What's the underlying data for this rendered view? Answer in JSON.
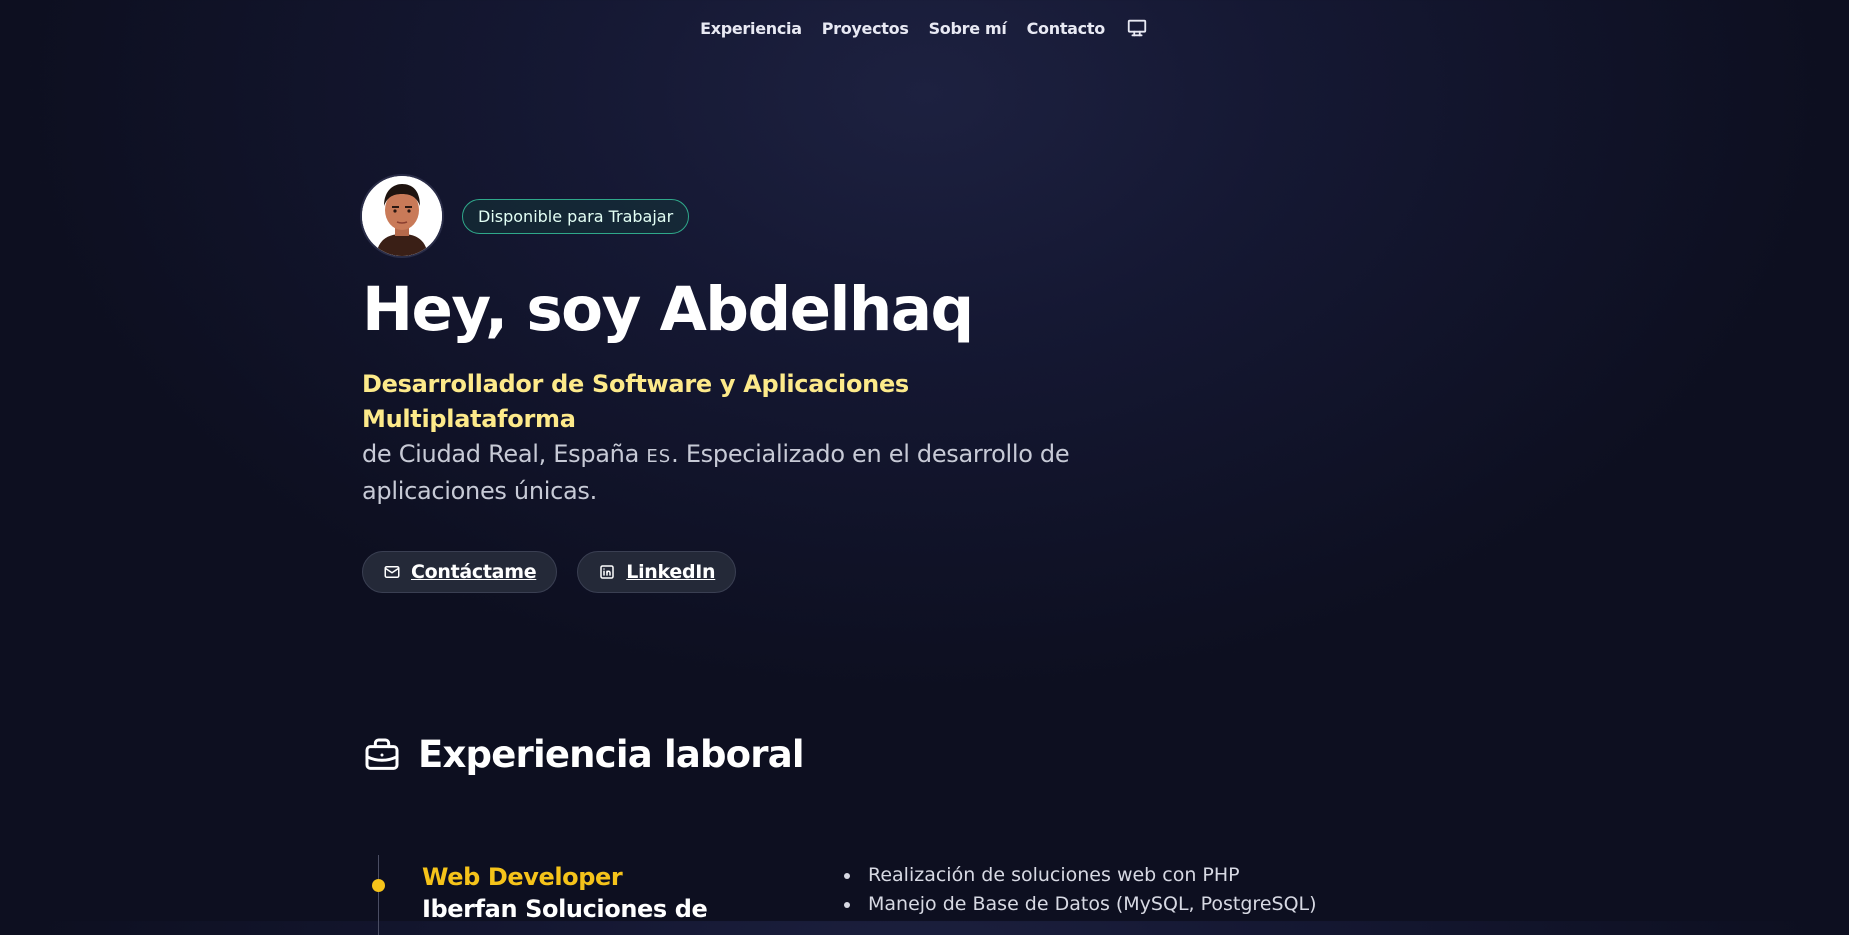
{
  "nav": {
    "items": [
      "Experiencia",
      "Proyectos",
      "Sobre mí",
      "Contacto"
    ],
    "theme_icon": "monitor-icon"
  },
  "hero": {
    "status_badge": "Disponible para Trabajar",
    "title": "Hey, soy Abdelhaq",
    "role": "Desarrollador de Software y Aplicaciones Multiplataforma",
    "location_prefix": "de Ciudad Real, España",
    "flag": "ES",
    "description_suffix": ". Especializado en el desarrollo de aplicaciones únicas.",
    "buttons": {
      "contact": "Contáctame",
      "linkedin": "LinkedIn"
    }
  },
  "experience": {
    "section_title": "Experiencia laboral",
    "section_icon": "briefcase-icon",
    "jobs": [
      {
        "role": "Web Developer",
        "company": "Iberfan Soluciones de",
        "tasks": [
          "Realización de soluciones web con PHP",
          "Manejo de Base de Datos (MySQL, PostgreSQL)"
        ]
      }
    ]
  },
  "colors": {
    "accent_yellow": "#f5c31a",
    "highlight_yellow": "#fdea8a",
    "status_green": "#2fa88a",
    "background": "#151833"
  }
}
